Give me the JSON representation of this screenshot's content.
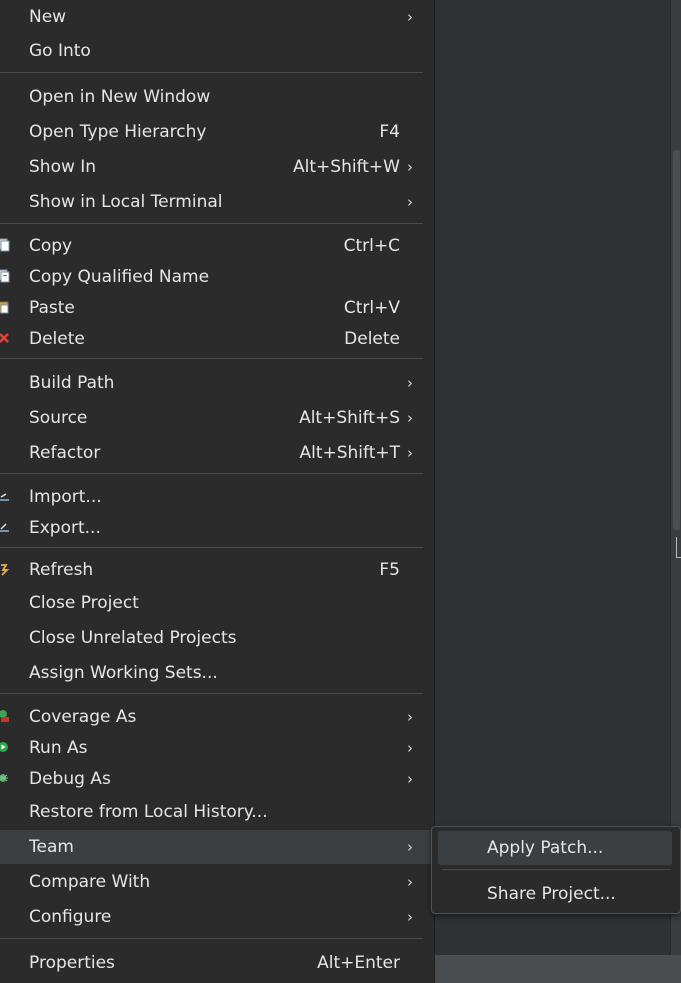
{
  "menu": {
    "groups": [
      [
        {
          "label": "New",
          "accel": "",
          "submenu": true,
          "icon": ""
        },
        {
          "label": "Go Into",
          "accel": "",
          "submenu": false,
          "icon": ""
        }
      ],
      [
        {
          "label": "Open in New Window",
          "accel": "",
          "submenu": false,
          "icon": ""
        },
        {
          "label": "Open Type Hierarchy",
          "accel": "F4",
          "submenu": false,
          "icon": ""
        },
        {
          "label": "Show In",
          "accel": "Alt+Shift+W",
          "submenu": true,
          "icon": ""
        },
        {
          "label": "Show in Local Terminal",
          "accel": "",
          "submenu": true,
          "icon": ""
        }
      ],
      [
        {
          "label": "Copy",
          "accel": "Ctrl+C",
          "submenu": false,
          "icon": "copy-icon"
        },
        {
          "label": "Copy Qualified Name",
          "accel": "",
          "submenu": false,
          "icon": "copy-qualified-name-icon"
        },
        {
          "label": "Paste",
          "accel": "Ctrl+V",
          "submenu": false,
          "icon": "paste-icon"
        },
        {
          "label": "Delete",
          "accel": "Delete",
          "submenu": false,
          "icon": "delete-icon"
        }
      ],
      [
        {
          "label": "Build Path",
          "accel": "",
          "submenu": true,
          "icon": ""
        },
        {
          "label": "Source",
          "accel": "Alt+Shift+S",
          "submenu": true,
          "icon": ""
        },
        {
          "label": "Refactor",
          "accel": "Alt+Shift+T",
          "submenu": true,
          "icon": ""
        }
      ],
      [
        {
          "label": "Import...",
          "accel": "",
          "submenu": false,
          "icon": "import-icon"
        },
        {
          "label": "Export...",
          "accel": "",
          "submenu": false,
          "icon": "export-icon"
        }
      ],
      [
        {
          "label": "Refresh",
          "accel": "F5",
          "submenu": false,
          "icon": "refresh-icon"
        },
        {
          "label": "Close Project",
          "accel": "",
          "submenu": false,
          "icon": ""
        },
        {
          "label": "Close Unrelated Projects",
          "accel": "",
          "submenu": false,
          "icon": ""
        },
        {
          "label": "Assign Working Sets...",
          "accel": "",
          "submenu": false,
          "icon": ""
        }
      ],
      [
        {
          "label": "Coverage As",
          "accel": "",
          "submenu": true,
          "icon": "coverage-icon"
        },
        {
          "label": "Run As",
          "accel": "",
          "submenu": true,
          "icon": "run-icon"
        },
        {
          "label": "Debug As",
          "accel": "",
          "submenu": true,
          "icon": "debug-icon"
        },
        {
          "label": "Restore from Local History...",
          "accel": "",
          "submenu": false,
          "icon": ""
        },
        {
          "label": "Team",
          "accel": "",
          "submenu": true,
          "icon": "",
          "highlighted": true
        },
        {
          "label": "Compare With",
          "accel": "",
          "submenu": true,
          "icon": ""
        },
        {
          "label": "Configure",
          "accel": "",
          "submenu": true,
          "icon": ""
        }
      ],
      [
        {
          "label": "Properties",
          "accel": "Alt+Enter",
          "submenu": false,
          "icon": ""
        }
      ]
    ]
  },
  "submenu_team": {
    "items": [
      {
        "label": "Apply Patch...",
        "highlighted": true
      },
      {
        "label": "Share Project...",
        "highlighted": false
      }
    ]
  },
  "glyphs": {
    "submenu_arrow": "›"
  },
  "colors": {
    "menu_bg": "#2b2b2b",
    "highlight": "#3c3f41",
    "text": "#e6e6e6",
    "separator": "#4a4a4a"
  }
}
